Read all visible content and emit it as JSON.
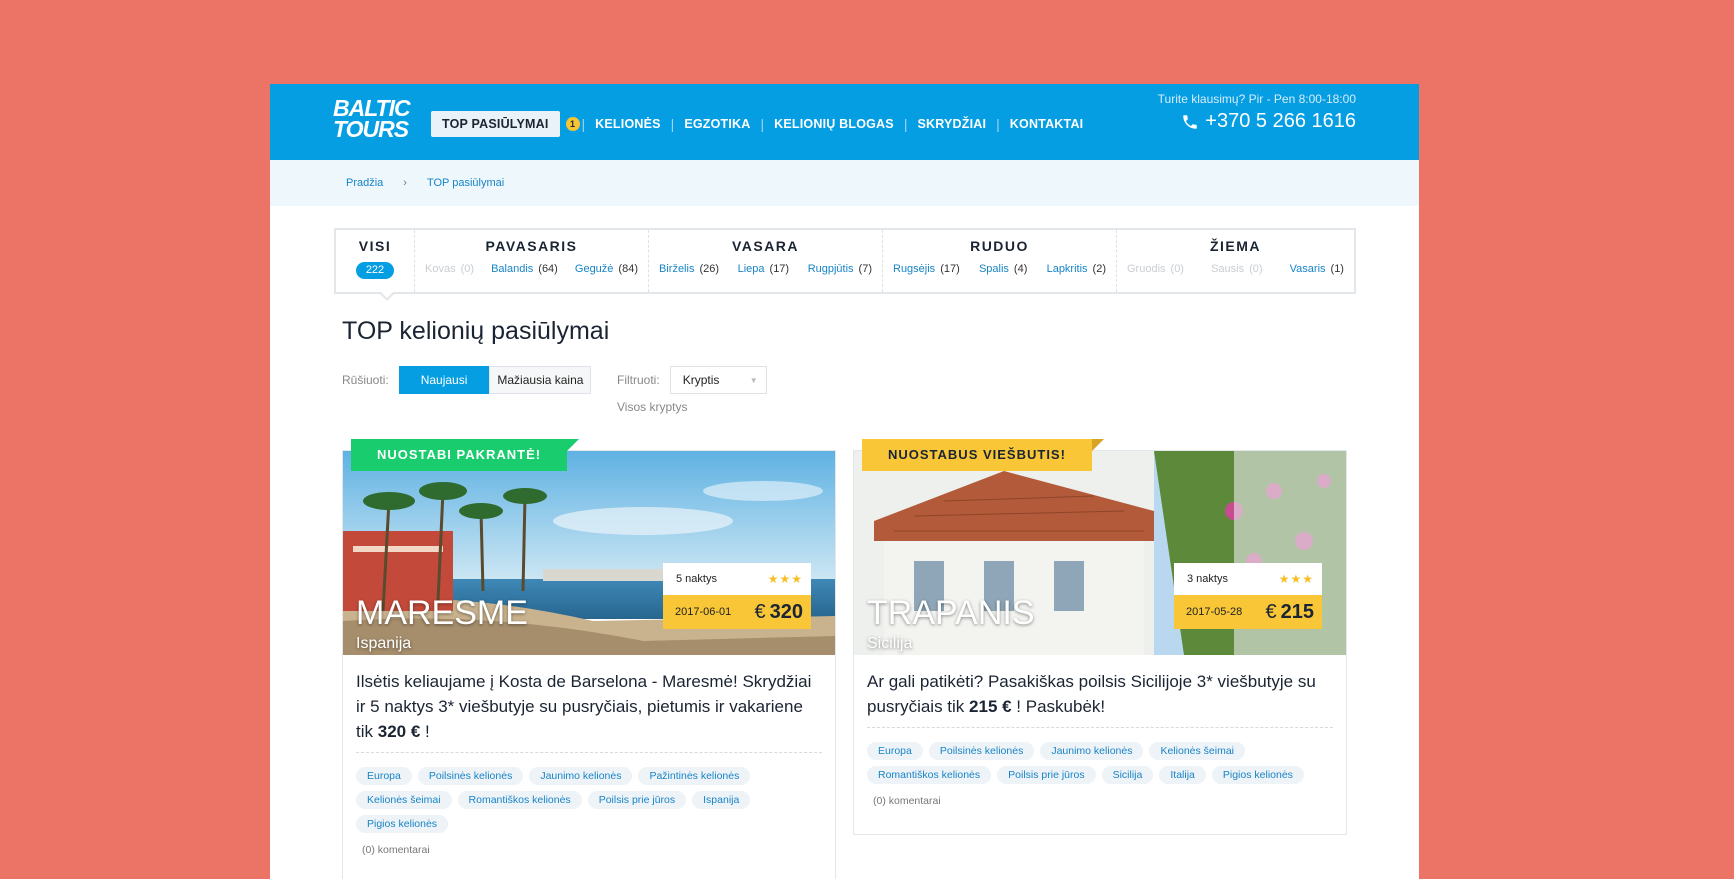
{
  "header": {
    "logo_line1": "BALTIC",
    "logo_line2": "TOURS",
    "nav": [
      {
        "label": "TOP PASIŪLYMAI",
        "badge": "1"
      },
      {
        "label": "KELIONĖS"
      },
      {
        "label": "EGZOTIKA"
      },
      {
        "label": "KELIONIŲ BLOGAS"
      },
      {
        "label": "SKRYDŽIAI"
      },
      {
        "label": "KONTAKTAI"
      }
    ],
    "contact_question": "Turite klausimų? Pir - Pen 8:00-18:00",
    "phone": "+370 5 266 1616",
    "brand_color": "#069ee3"
  },
  "breadcrumb": [
    "Pradžia",
    "TOP pasiūlymai"
  ],
  "seasons": {
    "all": {
      "label": "VISI",
      "count": "222"
    },
    "groups": [
      {
        "title": "PAVASARIS",
        "months": [
          {
            "name": "Kovas",
            "count": "(0)",
            "disabled": true
          },
          {
            "name": "Balandis",
            "count": "(64)",
            "disabled": false
          },
          {
            "name": "Gegužė",
            "count": "(84)",
            "disabled": false
          }
        ]
      },
      {
        "title": "VASARA",
        "months": [
          {
            "name": "Birželis",
            "count": "(26)",
            "disabled": false
          },
          {
            "name": "Liepa",
            "count": "(17)",
            "disabled": false
          },
          {
            "name": "Rugpjūtis",
            "count": "(7)",
            "disabled": false
          }
        ]
      },
      {
        "title": "RUDUO",
        "months": [
          {
            "name": "Rugsėjis",
            "count": "(17)",
            "disabled": false
          },
          {
            "name": "Spalis",
            "count": "(4)",
            "disabled": false
          },
          {
            "name": "Lapkritis",
            "count": "(2)",
            "disabled": false
          }
        ]
      },
      {
        "title": "ŽIEMA",
        "months": [
          {
            "name": "Gruodis",
            "count": "(0)",
            "disabled": true
          },
          {
            "name": "Sausis",
            "count": "(0)",
            "disabled": true
          },
          {
            "name": "Vasaris",
            "count": "(1)",
            "disabled": false
          }
        ]
      }
    ]
  },
  "title": "TOP kelionių pasiūlymai",
  "sort": {
    "label": "Rūšiuoti:",
    "options": [
      "Naujausi",
      "Mažiausia kaina"
    ],
    "active": "Naujausi"
  },
  "filter": {
    "label": "Filtruoti:",
    "select_value": "Kryptis",
    "sub": "Visos kryptys"
  },
  "cards": [
    {
      "ribbon": "NUOSTABI PAKRANTĖ!",
      "ribbon_color": "#19cd6f",
      "place": "MARESME",
      "country": "Ispanija",
      "nights": "5 naktys",
      "stars": "★★★",
      "date": "2017-06-01",
      "currency": "€",
      "price": "320",
      "desc_text": "Ilsėtis keliaujame į Kosta de Barselona - Maresmė! Skrydžiai ir 5 naktys 3* viešbutyje su pusryčiais, pietumis ir vakariene tik ",
      "desc_bold": "320 €",
      "desc_end": " !",
      "tags": [
        "Europa",
        "Poilsinės kelionės",
        "Jaunimo kelionės",
        "Pažintinės kelionės",
        "Kelionės šeimai",
        "Romantiškos kelionės",
        "Poilsis prie jūros",
        "Ispanija",
        "Pigios kelionės"
      ],
      "comments": "(0) komentarai"
    },
    {
      "ribbon": "NUOSTABUS VIEŠBUTIS!",
      "ribbon_color": "#f8c637",
      "place": "TRAPANIS",
      "country": "Sicilija",
      "nights": "3 naktys",
      "stars": "★★★",
      "date": "2017-05-28",
      "currency": "€",
      "price": "215",
      "desc_text": "Ar gali patikėti? Pasakiškas poilsis Sicilijoje 3* viešbutyje su pusryčiais tik ",
      "desc_bold": "215 €",
      "desc_end": " ! Paskubėk!",
      "tags": [
        "Europa",
        "Poilsinės kelionės",
        "Jaunimo kelionės",
        "Kelionės šeimai",
        "Romantiškos kelionės",
        "Poilsis prie jūros",
        "Sicilija",
        "Italija",
        "Pigios kelionės"
      ],
      "comments": "(0) komentarai"
    }
  ]
}
